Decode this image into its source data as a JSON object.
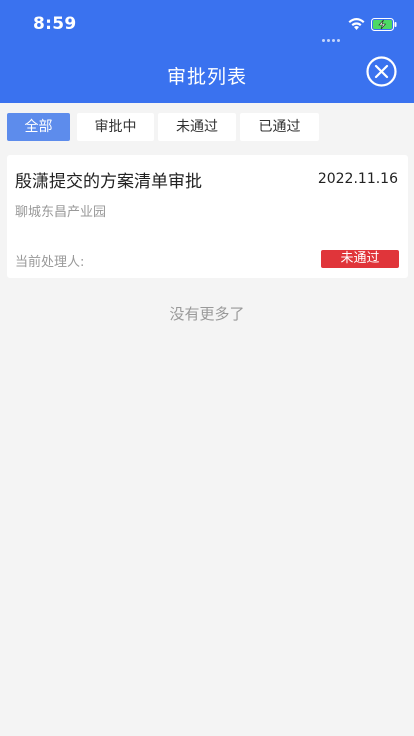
{
  "status_bar": {
    "time": "8:59"
  },
  "header": {
    "title": "审批列表",
    "close_icon": "close-circle-icon"
  },
  "tabs": [
    {
      "label": "全部",
      "active": true
    },
    {
      "label": "审批中",
      "active": false
    },
    {
      "label": "未通过",
      "active": false
    },
    {
      "label": "已通过",
      "active": false
    }
  ],
  "items": [
    {
      "title": "殷潇提交的方案清单审批",
      "date": "2022.11.16",
      "location": "聊城东昌产业园",
      "handler_label": "当前处理人:",
      "status": "未通过",
      "status_color": "#e0353a"
    }
  ],
  "footer": {
    "no_more": "没有更多了"
  },
  "colors": {
    "primary": "#3a72ef",
    "tab_active": "#5d8cec",
    "rejected": "#e0353a"
  }
}
